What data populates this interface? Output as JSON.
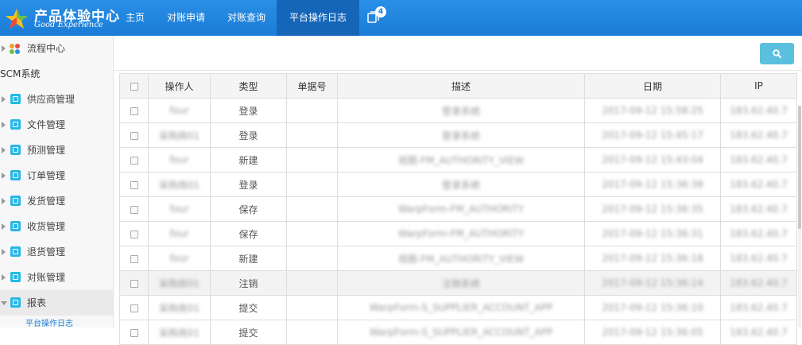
{
  "header": {
    "logo_cn": "产品体验中心",
    "logo_en": "Good Experience",
    "nav": [
      "主页",
      "对账申请",
      "对账查询",
      "平台操作日志"
    ],
    "active_nav": "平台操作日志",
    "message_count": "4"
  },
  "sidebar": {
    "flow_center": "流程中心",
    "section_title": "SCM系统",
    "items": [
      "供应商管理",
      "文件管理",
      "预测管理",
      "订单管理",
      "发货管理",
      "收货管理",
      "退货管理",
      "对账管理",
      "报表"
    ],
    "open_item": "报表",
    "sub_item": "平台操作日志"
  },
  "table": {
    "headers": [
      "操作人",
      "类型",
      "单据号",
      "描述",
      "日期",
      "IP"
    ],
    "rows": [
      {
        "operator": "four",
        "type": "登录",
        "doc": "",
        "desc": "登录系统",
        "date": "2017-09-12 15:58:25",
        "ip": "183.62.40.7"
      },
      {
        "operator": "采购商01",
        "type": "登录",
        "doc": "",
        "desc": "登录系统",
        "date": "2017-09-12 15:45:17",
        "ip": "183.62.40.7"
      },
      {
        "operator": "four",
        "type": "新建",
        "doc": "",
        "desc": "视图-FM_AUTHORITY_VIEW",
        "date": "2017-09-12 15:43:04",
        "ip": "183.62.40.7"
      },
      {
        "operator": "采购商01",
        "type": "登录",
        "doc": "",
        "desc": "登录系统",
        "date": "2017-09-12 15:36:38",
        "ip": "183.62.40.7"
      },
      {
        "operator": "four",
        "type": "保存",
        "doc": "",
        "desc": "WarpForm-FM_AUTHORITY",
        "date": "2017-09-12 15:36:35",
        "ip": "183.62.40.7"
      },
      {
        "operator": "four",
        "type": "保存",
        "doc": "",
        "desc": "WarpForm-FM_AUTHORITY",
        "date": "2017-09-12 15:36:31",
        "ip": "183.62.40.7"
      },
      {
        "operator": "four",
        "type": "新建",
        "doc": "",
        "desc": "视图-FM_AUTHORITY_VIEW",
        "date": "2017-09-12 15:36:18",
        "ip": "183.62.40.7"
      },
      {
        "operator": "采购商01",
        "type": "注销",
        "doc": "",
        "desc": "注销系统",
        "date": "2017-09-12 15:36:14",
        "ip": "183.62.40.7"
      },
      {
        "operator": "采购商01",
        "type": "提交",
        "doc": "",
        "desc": "WarpForm-S_SUPPLIER_ACCOUNT_APP",
        "date": "2017-09-12 15:36:10",
        "ip": "183.62.40.7"
      },
      {
        "operator": "采购商01",
        "type": "提交",
        "doc": "",
        "desc": "WarpForm-S_SUPPLIER_ACCOUNT_APP",
        "date": "2017-09-12 15:36:05",
        "ip": "183.62.40.7"
      }
    ]
  },
  "colors": {
    "header_bg": "#1a7cd6",
    "nav_active": "#1566b8",
    "menu_icon": "#27b8e8",
    "search_button": "#5bc0de"
  },
  "icons": {
    "logo": "star-logo-icon",
    "message": "message-icon",
    "search": "search-icon",
    "menu": "module-icon",
    "flow": "flower-icon"
  }
}
